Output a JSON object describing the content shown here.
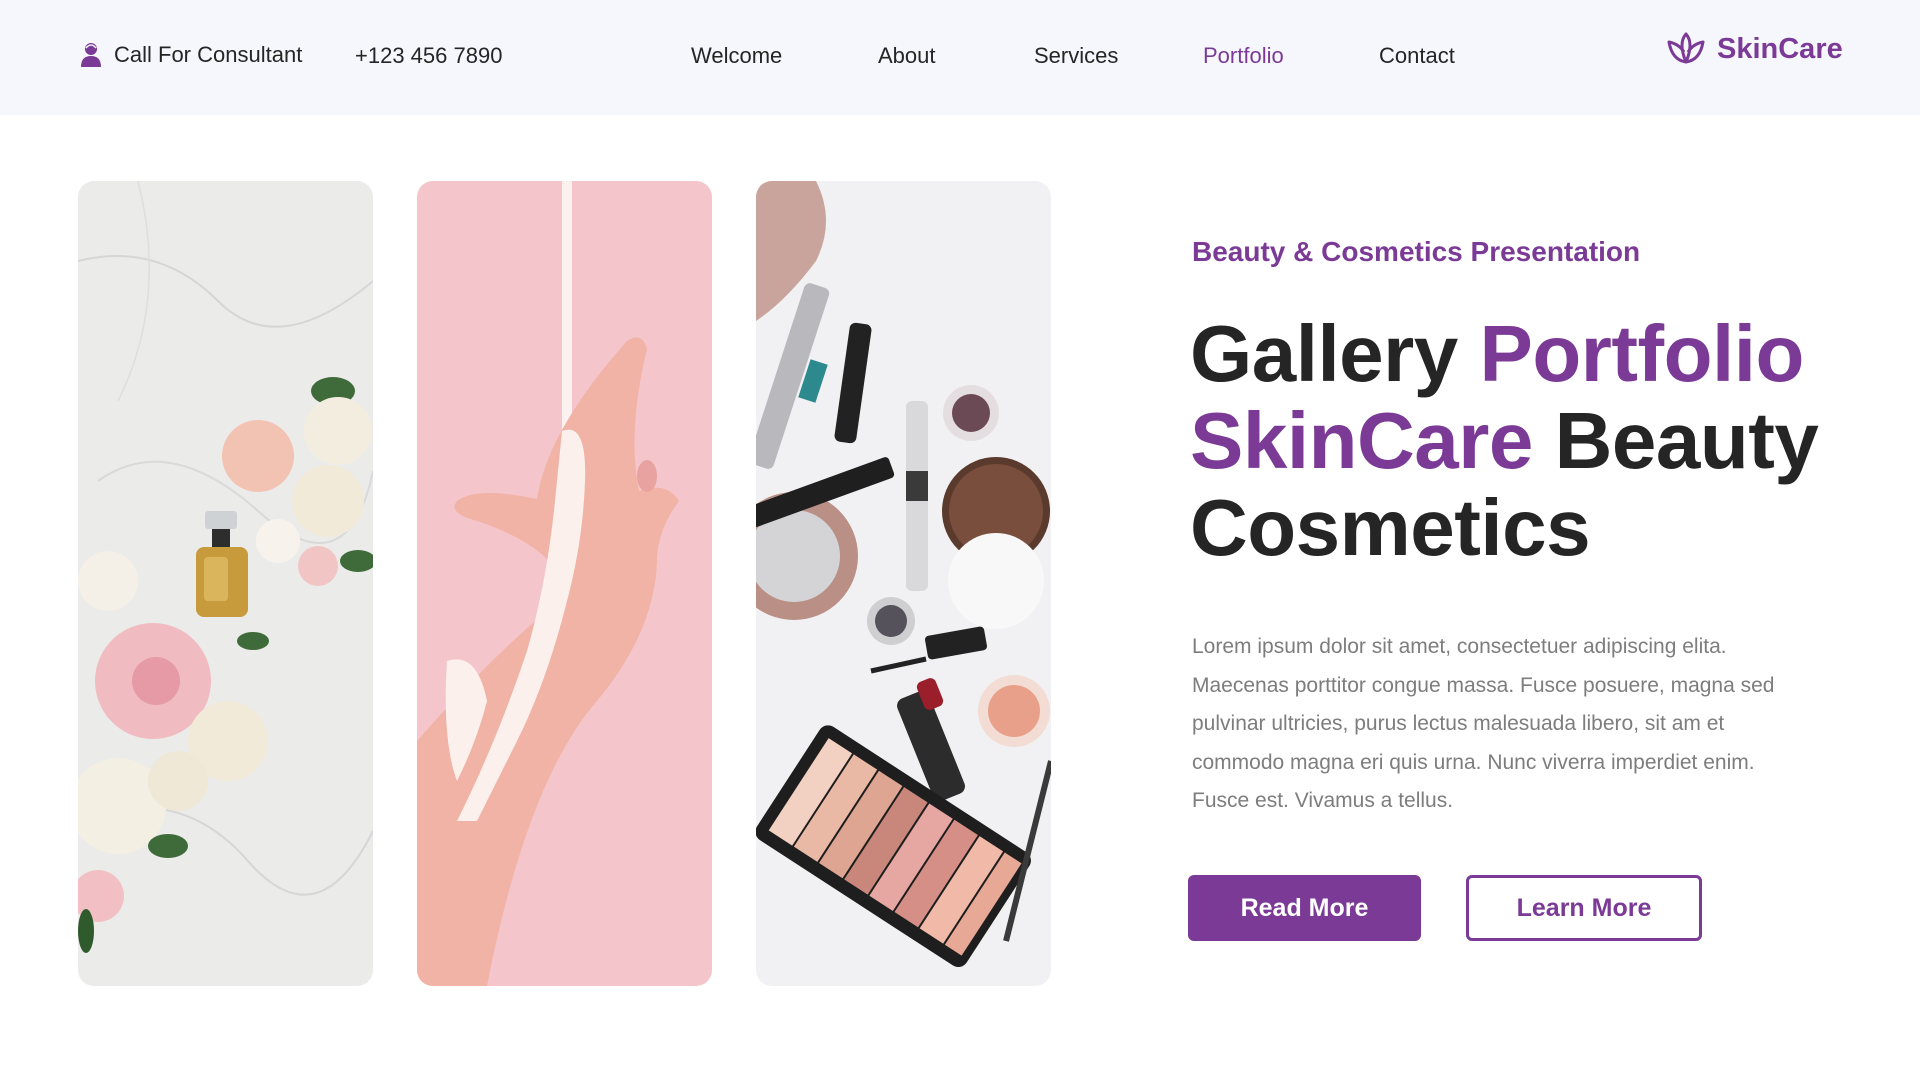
{
  "colors": {
    "accent": "#7b3a96",
    "text": "#252525",
    "muted": "#7d7d7d",
    "topbar_bg": "#f5f7fc"
  },
  "header": {
    "consult_icon": "person-icon",
    "consult_label": "Call For Consultant",
    "phone": "+123 456 7890",
    "nav": [
      "Welcome",
      "About",
      "Services",
      "Portfolio",
      "Contact"
    ],
    "active_nav": "Portfolio",
    "logo_icon": "lotus-icon",
    "logo_text": "SkinCare"
  },
  "gallery": [
    {
      "subject": "perfume-flowers-image"
    },
    {
      "subject": "hand-cream-image"
    },
    {
      "subject": "makeup-flatlay-image"
    }
  ],
  "hero": {
    "eyebrow": "Beauty & Cosmetics Presentation",
    "headline_1": "Gallery",
    "headline_2": "Portfolio",
    "headline_3": "SkinCare",
    "headline_4": "Beauty",
    "headline_5": "Cosmetics",
    "body": "Lorem ipsum dolor sit amet, consectetuer adipiscing elita. Maecenas porttitor congue massa. Fusce posuere, magna sed pulvinar ultricies, purus lectus malesuada libero, sit am et commodo magna eri quis urna. Nunc viverra imperdiet enim. Fusce est. Vivamus a tellus.",
    "btn_primary": "Read More",
    "btn_secondary": "Learn More"
  }
}
